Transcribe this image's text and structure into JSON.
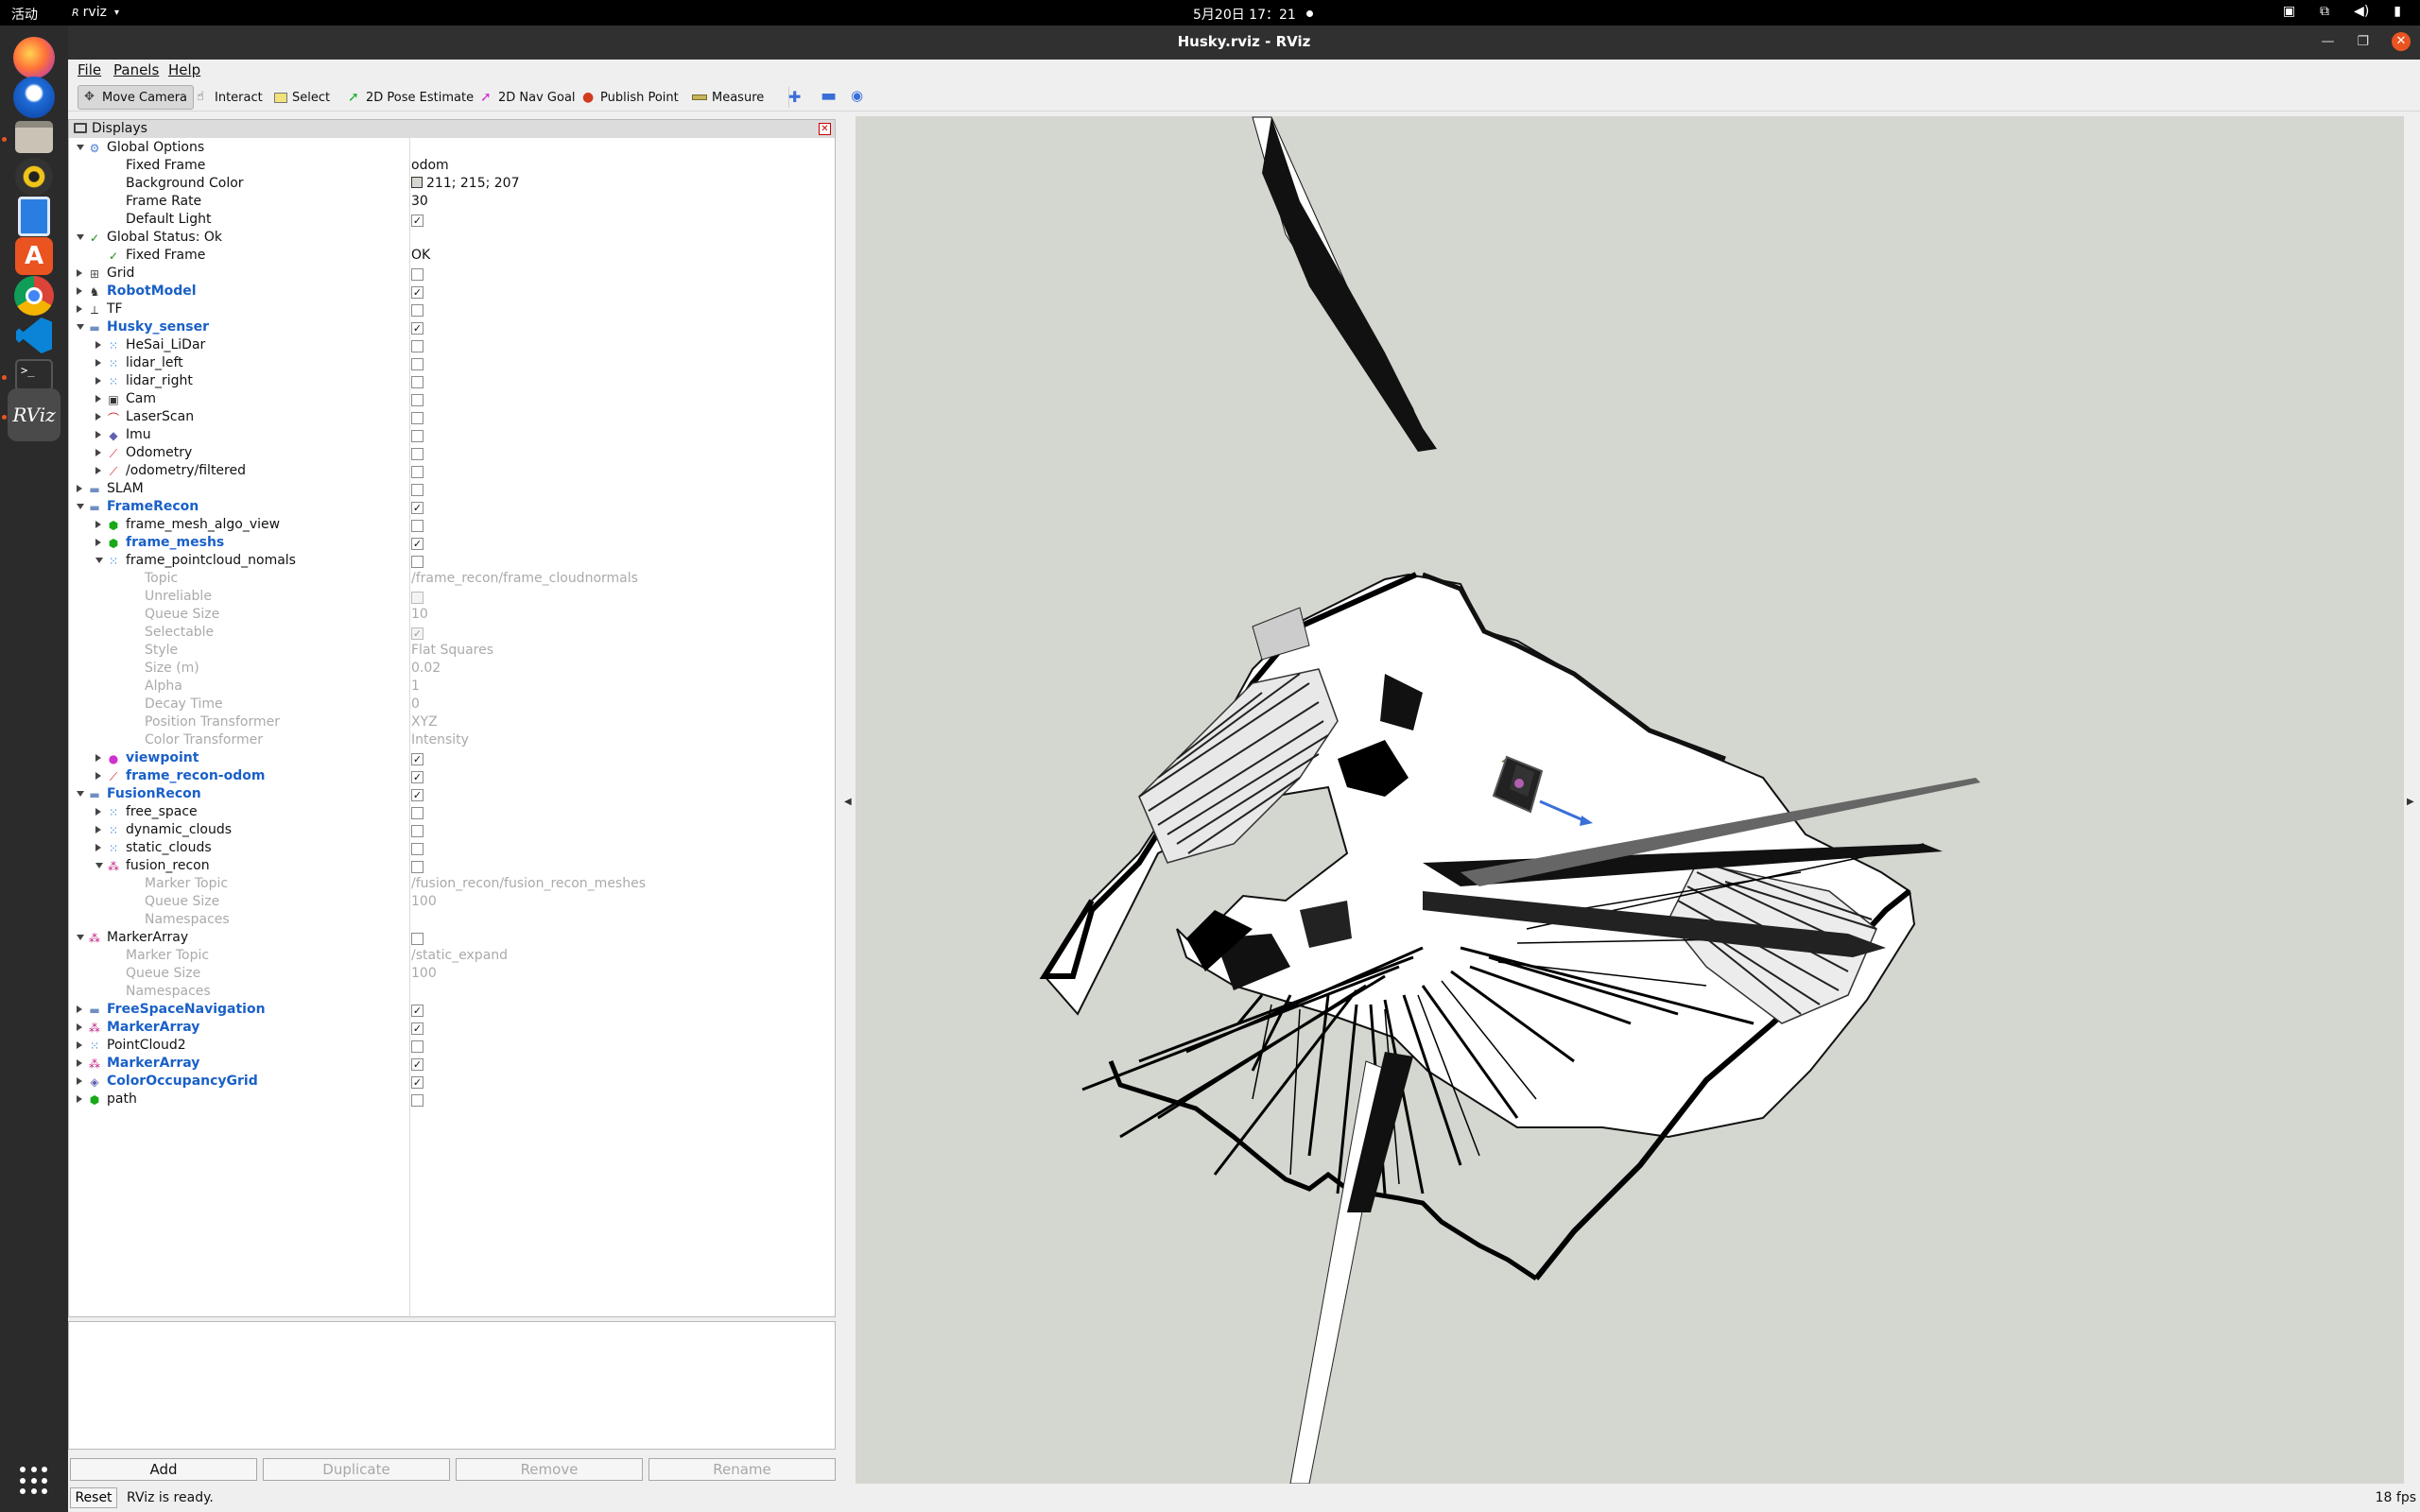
{
  "topbar": {
    "activities": "活动",
    "app_name": "rviz",
    "app_glyph": "R",
    "clock": "5月20日 17：21"
  },
  "window": {
    "title": "Husky.rviz - RViz"
  },
  "menu": {
    "file": "File",
    "panels": "Panels",
    "help": "Help"
  },
  "toolbar": {
    "move_camera": "Move Camera",
    "interact": "Interact",
    "select": "Select",
    "pose_estimate": "2D Pose Estimate",
    "nav_goal": "2D Nav Goal",
    "publish_point": "Publish Point",
    "measure": "Measure"
  },
  "displays": {
    "title": "Displays",
    "rows": [
      {
        "name": "Global Options",
        "indent": 0,
        "arrow": "open",
        "icon": "gear-icon"
      },
      {
        "name": "Fixed Frame",
        "indent": 1,
        "value": "odom"
      },
      {
        "name": "Background Color",
        "indent": 1,
        "value": "211; 215; 207",
        "swatch": true
      },
      {
        "name": "Frame Rate",
        "indent": 1,
        "value": "30"
      },
      {
        "name": "Default Light",
        "indent": 1,
        "check": true
      },
      {
        "name": "Global Status: Ok",
        "indent": 0,
        "arrow": "open",
        "icon": "check-icon"
      },
      {
        "name": "Fixed Frame",
        "indent": 1,
        "value": "OK",
        "icon": "check-icon"
      },
      {
        "name": "Grid",
        "indent": 0,
        "arrow": "closed",
        "icon": "grid-icon",
        "check": false
      },
      {
        "name": "RobotModel",
        "indent": 0,
        "arrow": "closed",
        "icon": "robot-icon",
        "check": true,
        "bold": true
      },
      {
        "name": "TF",
        "indent": 0,
        "arrow": "closed",
        "icon": "tf-icon",
        "check": false
      },
      {
        "name": "Husky_senser",
        "indent": 0,
        "arrow": "open",
        "icon": "folder-icon",
        "check": true,
        "bold": true
      },
      {
        "name": "HeSai_LiDar",
        "indent": 1,
        "arrow": "closed",
        "icon": "pointcloud-icon",
        "check": false
      },
      {
        "name": "lidar_left",
        "indent": 1,
        "arrow": "closed",
        "icon": "pointcloud-icon",
        "check": false
      },
      {
        "name": "lidar_right",
        "indent": 1,
        "arrow": "closed",
        "icon": "pointcloud-icon",
        "check": false
      },
      {
        "name": "Cam",
        "indent": 1,
        "arrow": "closed",
        "icon": "camera-icon",
        "check": false
      },
      {
        "name": "LaserScan",
        "indent": 1,
        "arrow": "closed",
        "icon": "laserscan-icon",
        "check": false
      },
      {
        "name": "Imu",
        "indent": 1,
        "arrow": "closed",
        "icon": "imu-icon",
        "check": false
      },
      {
        "name": "Odometry",
        "indent": 1,
        "arrow": "closed",
        "icon": "odometry-icon",
        "check": false
      },
      {
        "name": "/odometry/filtered",
        "indent": 1,
        "arrow": "closed",
        "icon": "odometry-icon",
        "check": false
      },
      {
        "name": "SLAM",
        "indent": 0,
        "arrow": "closed",
        "icon": "folder-icon",
        "check": false
      },
      {
        "name": "FrameRecon",
        "indent": 0,
        "arrow": "open",
        "icon": "folder-icon",
        "check": true,
        "bold": true
      },
      {
        "name": "frame_mesh_algo_view",
        "indent": 1,
        "arrow": "closed",
        "icon": "marker-icon",
        "check": false
      },
      {
        "name": "frame_meshs",
        "indent": 1,
        "arrow": "closed",
        "icon": "marker-icon",
        "check": true,
        "bold": true
      },
      {
        "name": "frame_pointcloud_nomals",
        "indent": 1,
        "arrow": "open",
        "icon": "pointcloud-icon",
        "check": false
      },
      {
        "name": "Topic",
        "indent": 2,
        "value": "/frame_recon/frame_cloudnormals",
        "grey": true
      },
      {
        "name": "Unreliable",
        "indent": 2,
        "check": false,
        "grey": true
      },
      {
        "name": "Queue Size",
        "indent": 2,
        "value": "10",
        "grey": true
      },
      {
        "name": "Selectable",
        "indent": 2,
        "check": true,
        "grey": true
      },
      {
        "name": "Style",
        "indent": 2,
        "value": "Flat Squares",
        "grey": true
      },
      {
        "name": "Size (m)",
        "indent": 2,
        "value": "0.02",
        "grey": true
      },
      {
        "name": "Alpha",
        "indent": 2,
        "value": "1",
        "grey": true
      },
      {
        "name": "Decay Time",
        "indent": 2,
        "value": "0",
        "grey": true
      },
      {
        "name": "Position Transformer",
        "indent": 2,
        "value": "XYZ",
        "grey": true
      },
      {
        "name": "Color Transformer",
        "indent": 2,
        "value": "Intensity",
        "grey": true
      },
      {
        "name": "viewpoint",
        "indent": 1,
        "arrow": "closed",
        "icon": "point-icon",
        "check": true,
        "bold": true
      },
      {
        "name": "frame_recon-odom",
        "indent": 1,
        "arrow": "closed",
        "icon": "odometry-icon",
        "check": true,
        "bold": true
      },
      {
        "name": "FusionRecon",
        "indent": 0,
        "arrow": "open",
        "icon": "folder-icon",
        "check": true,
        "bold": true
      },
      {
        "name": "free_space",
        "indent": 1,
        "arrow": "closed",
        "icon": "pointcloud-icon",
        "check": false
      },
      {
        "name": "dynamic_clouds",
        "indent": 1,
        "arrow": "closed",
        "icon": "pointcloud-icon",
        "check": false
      },
      {
        "name": "static_clouds",
        "indent": 1,
        "arrow": "closed",
        "icon": "pointcloud-icon",
        "check": false
      },
      {
        "name": "fusion_recon",
        "indent": 1,
        "arrow": "open",
        "icon": "markerarray-icon",
        "check": false
      },
      {
        "name": "Marker Topic",
        "indent": 2,
        "value": "/fusion_recon/fusion_recon_meshes",
        "grey": true
      },
      {
        "name": "Queue Size",
        "indent": 2,
        "value": "100",
        "grey": true
      },
      {
        "name": "Namespaces",
        "indent": 2,
        "grey": true
      },
      {
        "name": "MarkerArray",
        "indent": 0,
        "arrow": "open",
        "icon": "markerarray-icon",
        "check": false
      },
      {
        "name": "Marker Topic",
        "indent": 1,
        "value": "/static_expand",
        "grey": true
      },
      {
        "name": "Queue Size",
        "indent": 1,
        "value": "100",
        "grey": true
      },
      {
        "name": "Namespaces",
        "indent": 1,
        "grey": true
      },
      {
        "name": "FreeSpaceNavigation",
        "indent": 0,
        "arrow": "closed",
        "icon": "folder-icon",
        "check": true,
        "bold": true
      },
      {
        "name": "MarkerArray",
        "indent": 0,
        "arrow": "closed",
        "icon": "markerarray-icon",
        "check": true,
        "bold": true
      },
      {
        "name": "PointCloud2",
        "indent": 0,
        "arrow": "closed",
        "icon": "pointcloud-icon",
        "check": false
      },
      {
        "name": "MarkerArray",
        "indent": 0,
        "arrow": "closed",
        "icon": "markerarray-icon",
        "check": true,
        "bold": true
      },
      {
        "name": "ColorOccupancyGrid",
        "indent": 0,
        "arrow": "closed",
        "icon": "map-icon",
        "check": true,
        "bold": true
      },
      {
        "name": "path",
        "indent": 0,
        "arrow": "closed",
        "icon": "marker-icon",
        "check": false
      }
    ]
  },
  "buttons": {
    "add": "Add",
    "duplicate": "Duplicate",
    "remove": "Remove",
    "rename": "Rename"
  },
  "status": {
    "reset": "Reset",
    "message": "RViz is ready.",
    "fps": "18 fps"
  },
  "colors": {
    "background": "#d3d7cf",
    "accent": "#1a60c8",
    "close": "#e95420"
  }
}
